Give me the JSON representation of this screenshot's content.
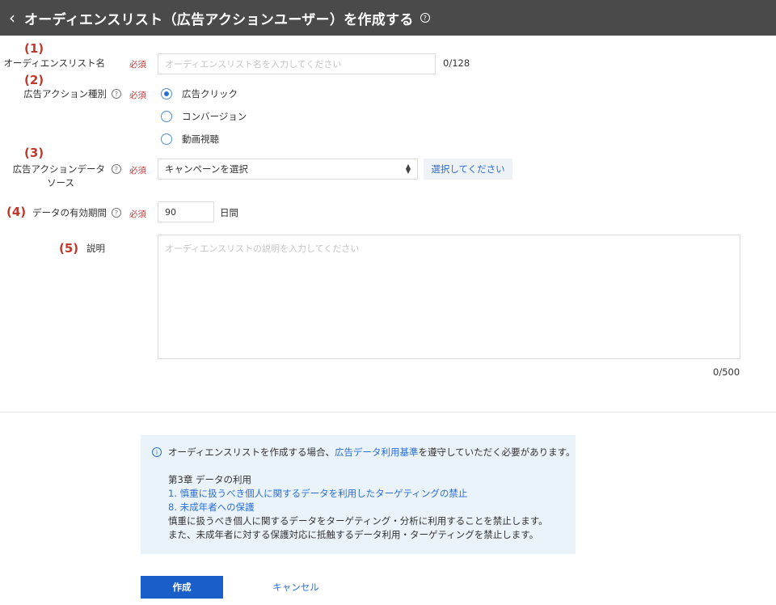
{
  "header": {
    "back_icon": "chevron-left-icon",
    "title": "オーディエンスリスト（広告アクションユーザー）を作成する",
    "help_icon": "question-circle-icon"
  },
  "annotations": [
    "(1)",
    "(2)",
    "(3)",
    "(4)",
    "(5)"
  ],
  "required_label": "必須",
  "help_glyph": "?",
  "form": {
    "name": {
      "label": "オーディエンスリスト名",
      "placeholder": "オーディエンスリスト名を入力してください",
      "counter": "0/128"
    },
    "action_type": {
      "label": "広告アクション種別",
      "options": [
        {
          "label": "広告クリック",
          "selected": true
        },
        {
          "label": "コンバージョン",
          "selected": false
        },
        {
          "label": "動画視聴",
          "selected": false
        }
      ]
    },
    "data_source": {
      "label_line1": "広告アクションデータ",
      "label_line2": "ソース",
      "select_value": "キャンペーンを選択",
      "button": "選択してください"
    },
    "validity": {
      "label": "データの有効期間",
      "value": "90",
      "unit": "日間"
    },
    "description": {
      "label": "説明",
      "placeholder": "オーディエンスリストの説明を入力してください",
      "counter": "0/500"
    }
  },
  "notice": {
    "icon": "info-circle-icon",
    "line1_before": "オーディエンスリストを作成する場合、",
    "line1_link": "広告データ利用基準",
    "line1_after": "を遵守していただく必要があります。",
    "chapter": "第3章 データの利用",
    "link1": "1. 慎重に扱うべき個人に関するデータを利用したターゲティングの禁止",
    "link2": "8. 未成年者への保護",
    "body1": "慎重に扱うべき個人に関するデータをターゲティング・分析に利用することを禁止します。",
    "body2": "また、未成年者に対する保護対応に抵触するデータ利用・ターゲティングを禁止します。"
  },
  "actions": {
    "create": "作成",
    "cancel": "キャンセル"
  },
  "colors": {
    "header_bg": "#4a4a4a",
    "accent": "#1a5fc9",
    "link": "#2a6fd6",
    "required": "#e03030",
    "annotation": "#c0392b",
    "notice_bg": "#eaf2fa"
  }
}
